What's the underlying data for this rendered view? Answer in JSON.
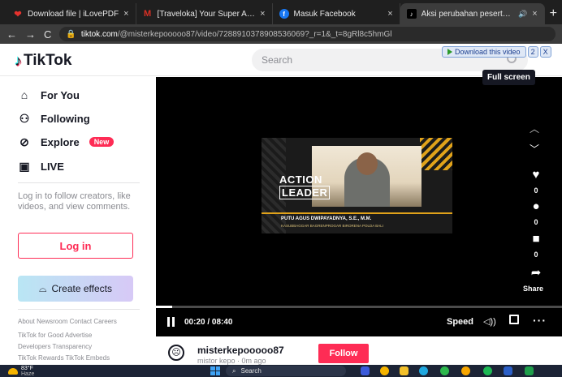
{
  "browser": {
    "tabs": [
      {
        "title": "Download file | iLovePDF",
        "favicon": "heart-icon",
        "color": "#e5322d"
      },
      {
        "title": "[Traveloka] Your Super Air Jet E",
        "favicon": "gmail-icon",
        "color": "#d93025"
      },
      {
        "title": "Masuk Facebook",
        "favicon": "facebook-icon",
        "color": "#1877f2"
      },
      {
        "title": "Aksi perubahan peserta PKA",
        "favicon": "tiktok-icon",
        "color": "#000000",
        "active": true
      }
    ],
    "url_domain": "tiktok.com",
    "url_path": "/@misterkepooooo87/video/7288910378908536069?_r=1&_t=8gRl8c5hmGl"
  },
  "header": {
    "logo": "TikTok",
    "search_placeholder": "Search"
  },
  "extension": {
    "download_label": "Download this video",
    "badge": "2",
    "close": "X"
  },
  "sidebar": {
    "items": [
      {
        "label": "For You",
        "icon": "home-icon"
      },
      {
        "label": "Following",
        "icon": "following-icon"
      },
      {
        "label": "Explore",
        "icon": "compass-icon",
        "badge": "New"
      },
      {
        "label": "LIVE",
        "icon": "live-icon"
      }
    ],
    "login_prompt": "Log in to follow creators, like videos, and view comments.",
    "login_button": "Log in",
    "effects_button": "Create effects",
    "footer": [
      "About  Newsroom  Contact  Careers",
      "TikTok for Good  Advertise",
      "Developers  Transparency",
      "TikTok Rewards  TikTok Embeds"
    ]
  },
  "player": {
    "tooltip": "Full screen",
    "video_overlay": {
      "title_line1": "ACTION",
      "title_line2": "LEADER",
      "name": "PUTU AGUS DWIPAYADNYA, S.E., M.M.",
      "rank": "KASUBBAGGAR BAGRENPROGAR BIRORENA POLDA BALI"
    },
    "actions": [
      {
        "icon": "heart-icon",
        "count": "0"
      },
      {
        "icon": "comment-icon",
        "count": "0"
      },
      {
        "icon": "bookmark-icon",
        "count": "0"
      },
      {
        "icon": "share-icon",
        "count": "Share"
      }
    ],
    "progress": 0.04,
    "time": "00:20 / 08:40",
    "speed_label": "Speed"
  },
  "account": {
    "username": "misterkepooooo87",
    "sub": "mistor kepo · 0m ago",
    "follow_label": "Follow"
  },
  "taskbar": {
    "temp": "83°F",
    "condition": "Haze",
    "search": "Search"
  }
}
